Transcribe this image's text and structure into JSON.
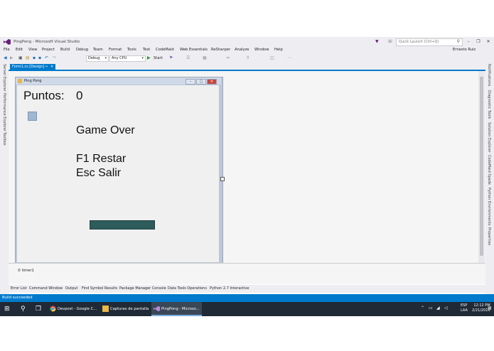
{
  "window": {
    "title": "PingPong - Microsoft Visual Studio"
  },
  "quick_launch": {
    "placeholder": "Quick Launch (Ctrl+Q)"
  },
  "user": {
    "name": "Ernesto Ruiz"
  },
  "menu": [
    "File",
    "Edit",
    "View",
    "Project",
    "Build",
    "Debug",
    "Team",
    "Format",
    "Tools",
    "Test",
    "CodeMaid",
    "Web Essentials",
    "ReSharper",
    "Analyze",
    "Window",
    "Help"
  ],
  "toolbar": {
    "config": "Debug",
    "platform": "Any CPU",
    "start_label": "Start"
  },
  "left_panels": [
    "Server Explorer",
    "Performance Explorer",
    "Toolbox"
  ],
  "right_panels": [
    "Notifications",
    "Diagnostic Tools",
    "Solution Explorer",
    "CodeMaid Spade",
    "Python Environments",
    "Properties"
  ],
  "doc_tab": {
    "label": "Form1.cs [Design]"
  },
  "form": {
    "caption": "Ping Pong",
    "score_label": "Puntos:",
    "score_value": "0",
    "game_over": "Game Over",
    "restart_hint": "F1 Restar",
    "exit_hint": "Esc Salir"
  },
  "tray": {
    "component": "timer1"
  },
  "bottom_tabs": [
    "Error List",
    "Command Window",
    "Output",
    "Find Symbol Results",
    "Package Manager Console",
    "Data Tools Operations",
    "Python 2.7 Interactive"
  ],
  "status": {
    "text": "Build succeeded"
  },
  "taskbar": {
    "apps": [
      {
        "label": "Devpost - Google C..."
      },
      {
        "label": "Capturas de pantalla"
      },
      {
        "label": "PingPong - Microso..."
      }
    ],
    "lang_1": "ESP",
    "lang_2": "LAA",
    "time": "12:12 PM",
    "date": "2/21/2016"
  },
  "colors": {
    "accent": "#007acc",
    "taskbar": "#1f2a36",
    "paddle": "#2e5c5c",
    "ball": "#9fb7d0"
  }
}
